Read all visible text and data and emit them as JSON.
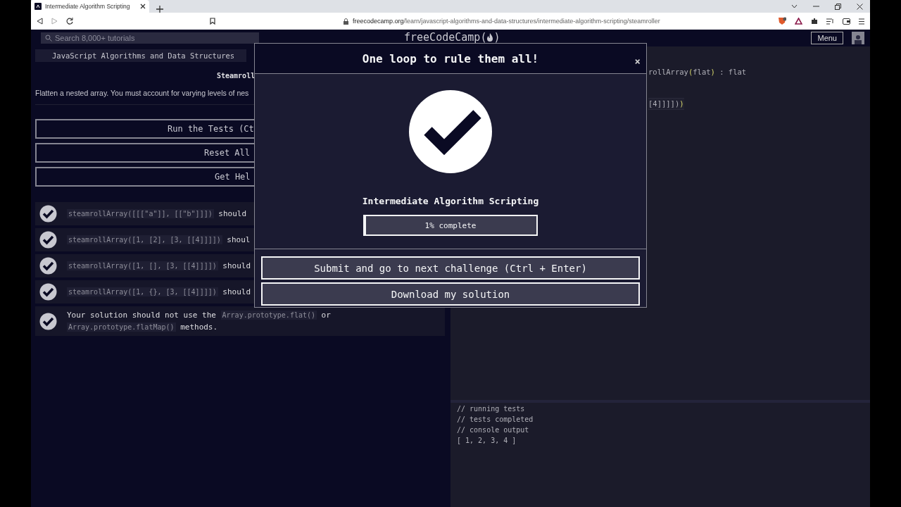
{
  "browser": {
    "tab_title": "Intermediate Algorithm Scripting",
    "url_host": "freecodecamp.org",
    "url_path": "/learn/javascript-algorithms-and-data-structures/intermediate-algorithm-scripting/steamroller"
  },
  "navbar": {
    "search_placeholder": "Search 8,000+ tutorials",
    "logo_text": "freeCodeCamp",
    "logo_open": "(",
    "logo_close": ")",
    "menu_button": "Menu"
  },
  "lesson": {
    "breadcrumb": "JavaScript Algorithms and Data Structures",
    "title": "Steamroll",
    "description": "Flatten a nested array. You must account for varying levels of nes",
    "buttons": [
      "Run the Tests (Ct",
      "Reset All",
      "Get Hel"
    ],
    "tests": [
      {
        "passed": true,
        "parts": [
          {
            "kind": "code",
            "text": "steamrollArray([[[\"a\"]], [[\"b\"]]])"
          },
          {
            "kind": "text",
            "text": " should"
          }
        ]
      },
      {
        "passed": true,
        "parts": [
          {
            "kind": "code",
            "text": "steamrollArray([1, [2], [3, [[4]]]])"
          },
          {
            "kind": "text",
            "text": " shoul"
          }
        ]
      },
      {
        "passed": true,
        "parts": [
          {
            "kind": "code",
            "text": "steamrollArray([1, [], [3, [[4]]]])"
          },
          {
            "kind": "text",
            "text": " should"
          }
        ]
      },
      {
        "passed": true,
        "parts": [
          {
            "kind": "code",
            "text": "steamrollArray([1, {}, [3, [[4]]]])"
          },
          {
            "kind": "text",
            "text": " should"
          }
        ]
      },
      {
        "passed": true,
        "parts": [
          {
            "kind": "text",
            "text": "Your solution should not use the "
          },
          {
            "kind": "code",
            "text": "Array.prototype.flat()"
          },
          {
            "kind": "text",
            "text": " or "
          },
          {
            "kind": "code",
            "text": "Array.prototype.flatMap()"
          },
          {
            "kind": "text",
            "text": " methods."
          }
        ]
      }
    ]
  },
  "editor": {
    "lines": [
      [
        {
          "kind": "plain",
          "text": "rollArray"
        },
        {
          "kind": "punct",
          "text": "("
        },
        {
          "kind": "plain",
          "text": "flat"
        },
        {
          "kind": "punct",
          "text": ")"
        },
        {
          "kind": "plain",
          "text": " : flat"
        }
      ],
      [
        {
          "kind": "plain",
          "text": "[4]]]])"
        },
        {
          "kind": "punct",
          "text": ")"
        }
      ]
    ],
    "console": [
      "// running tests",
      "// tests completed",
      "// console output",
      "[ 1, 2, 3, 4 ]"
    ]
  },
  "modal": {
    "title": "One loop to rule them all!",
    "close": "×",
    "block_title": "Intermediate Algorithm Scripting",
    "progress": {
      "level": 0.01,
      "label": "1% complete"
    },
    "buttons": [
      "Submit and go to next challenge (Ctrl + Enter)",
      "Download my solution"
    ]
  }
}
